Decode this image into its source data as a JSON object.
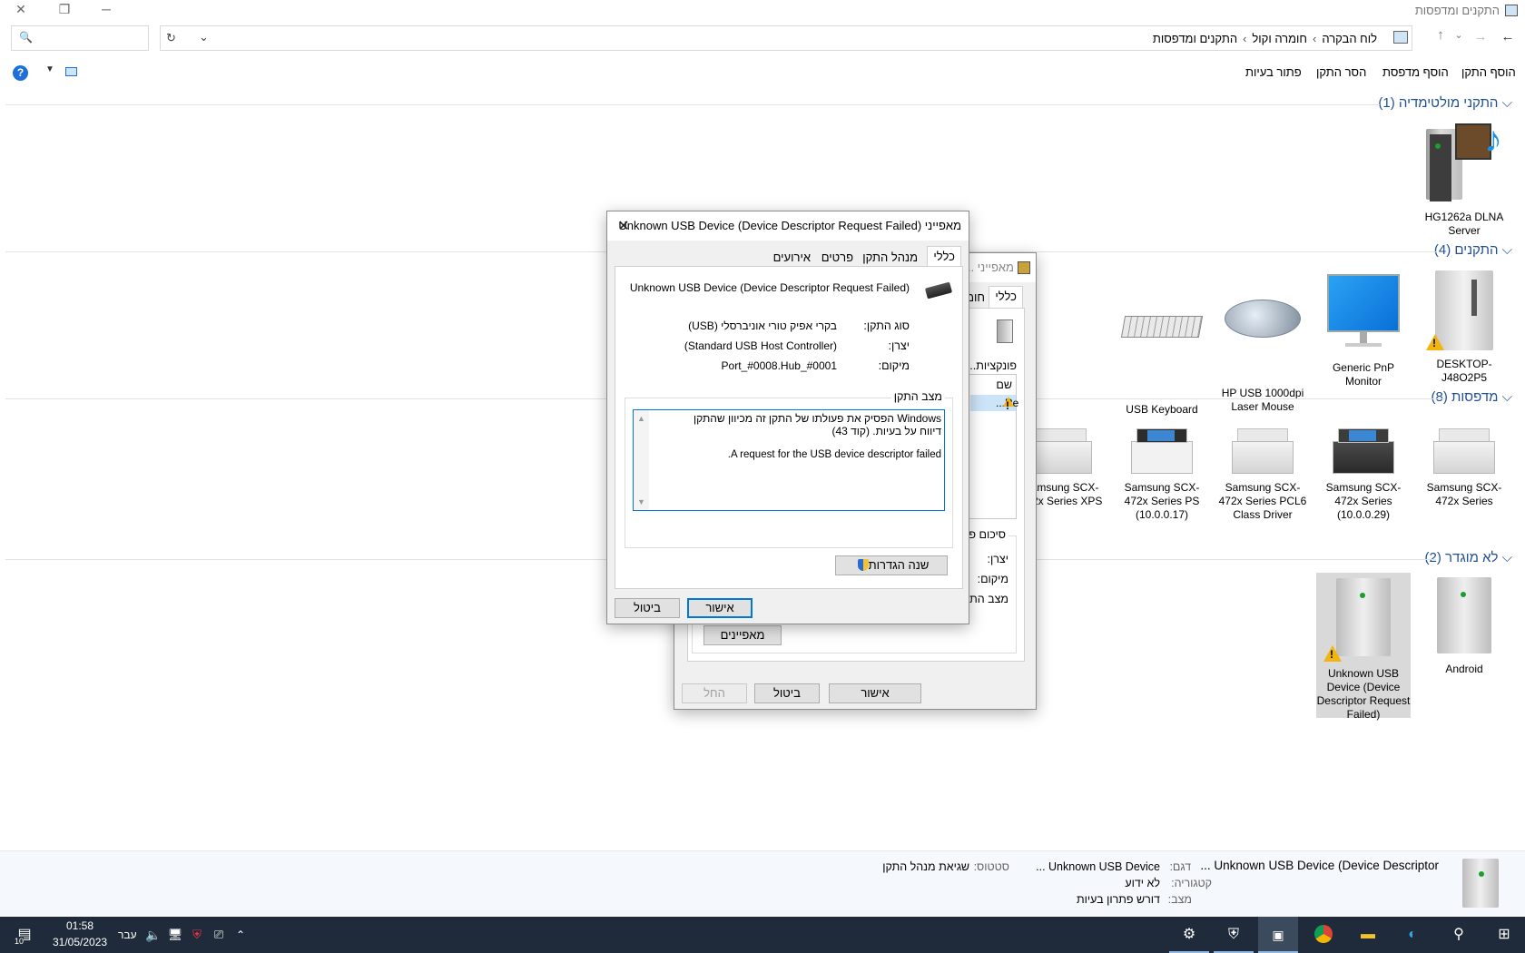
{
  "window": {
    "title": "התקנים ומדפסות",
    "controls": {
      "minimize": "─",
      "maximize": "❐",
      "close": "✕"
    }
  },
  "address": {
    "breadcrumb": [
      "לוח הבקרה",
      "חומרה וקול",
      "התקנים ומדפסות"
    ],
    "separator": "›"
  },
  "commands": {
    "add_device": "הוסף התקן",
    "add_printer": "הוסף מדפסת",
    "remove_device": "הסר התקן",
    "troubleshoot": "פתור בעיות",
    "help": "?"
  },
  "groups": {
    "multimedia": {
      "header": "התקני מולטימדיה (1)",
      "items": [
        {
          "label": "HG1262a DLNA Server",
          "icon": "dlna-server-icon"
        }
      ]
    },
    "devices": {
      "header": "התקנים (4)",
      "items": [
        {
          "label": "DESKTOP-J48O2P5",
          "icon": "computer-icon"
        },
        {
          "label": "Generic PnP Monitor",
          "icon": "monitor-icon"
        },
        {
          "label": "HP USB 1000dpi Laser Mouse",
          "icon": "mouse-icon"
        },
        {
          "label": "USB Keyboard",
          "icon": "keyboard-icon"
        }
      ]
    },
    "printers": {
      "header": "מדפסות (8)",
      "items": [
        {
          "label": "Samsung SCX-472x Series",
          "icon": "printer-icon"
        },
        {
          "label": "Samsung SCX-472x Series (10.0.0.29)",
          "icon": "printer-icon"
        },
        {
          "label": "Samsung SCX-472x Series PCL6 Class Driver",
          "icon": "printer-icon"
        },
        {
          "label": "Samsung SCX-472x Series PS (10.0.0.17)",
          "icon": "printer-icon"
        },
        {
          "label": "Samsung SCX-472x Series XPS",
          "icon": "printer-icon"
        }
      ]
    },
    "unspecified": {
      "header": "לא מוגדר (2)",
      "items": [
        {
          "label": "Android",
          "icon": "device-icon"
        },
        {
          "label": "Unknown USB Device (Device Descriptor Request Failed)",
          "icon": "device-warning-icon"
        }
      ]
    }
  },
  "details_pane": {
    "name": "Unknown USB Device (Device Descriptor ...",
    "model_key": "דגם:",
    "model_value": "Unknown USB Device ...",
    "status_key": "סטטוס:",
    "status_value": "שגיאת מנהל התקן",
    "category_key": "קטגוריה:",
    "category_value": "לא ידוע",
    "state_key": "מצב:",
    "state_value": "דורש פתרון בעיות"
  },
  "back_dialog": {
    "title": "מאפייני ...",
    "tabs": [
      "כללי",
      "חומ"
    ],
    "function_label": "פונקציות...",
    "name_header": "שם",
    "row_text": "...Re",
    "summary_label": "סיכום פ...",
    "manufacturer_key": "יצרן:",
    "location_key": "מיקום:",
    "status_key": "מצב התקן:",
    "properties_button": "מאפיינים",
    "ok": "אישור",
    "cancel": "ביטול",
    "apply": "החל"
  },
  "front_dialog": {
    "title": "מאפייני Unknown USB Device (Device Descriptor Request Failed)",
    "tabs": [
      "כללי",
      "מנהל התקן",
      "פרטים",
      "אירועים"
    ],
    "device_name": "Unknown USB Device (Device Descriptor Request Failed)",
    "type_key": "סוג התקן:",
    "type_value": "בקרי אפיק טורי אוניברסלי (USB)",
    "manufacturer_key": "יצרן:",
    "manufacturer_value": "(Standard USB Host Controller)",
    "location_key": "מיקום:",
    "location_value": "Port_#0008.Hub_#0001",
    "status_group": "מצב התקן",
    "status_line1": "Windows הפסיק את פעולתו של התקן זה מכיוון שהתקן דיווח על בעיות. (קוד 43)",
    "status_line2": "A request for the USB device descriptor failed.",
    "change_settings": "שנה הגדרות",
    "ok": "אישור",
    "cancel": "ביטול"
  },
  "taskbar": {
    "time": "01:58",
    "date": "31/05/2023",
    "language": "עבר",
    "notifications": "10"
  }
}
